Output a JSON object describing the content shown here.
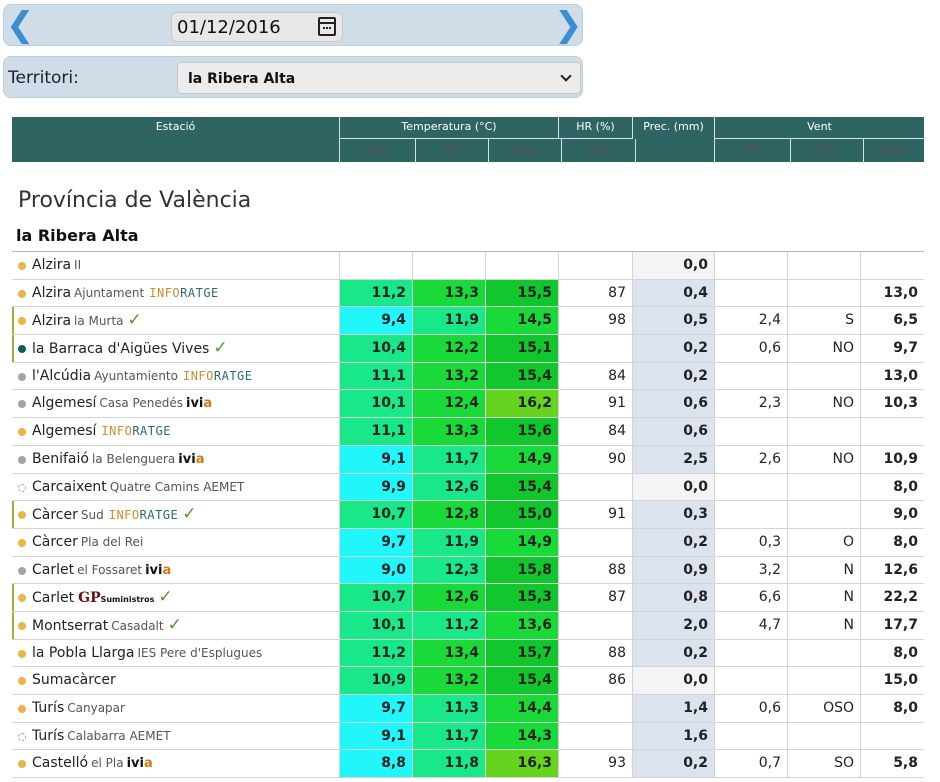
{
  "date": {
    "value": "01/12/2016"
  },
  "territory": {
    "label": "Territori:",
    "selected": "la Ribera Alta"
  },
  "header": {
    "station": "Estació",
    "temperature": "Temperatura (°C)",
    "hr": "HR (%)",
    "prec": "Prec. (mm)",
    "wind": "Vent",
    "sub": {
      "min": "Mín",
      "mit": "Mit",
      "max": "Màx",
      "hr_mit": "Mit",
      "wind_mit": "Mit",
      "dir": "Dir",
      "wind_max": "Màx"
    }
  },
  "province": "Província de València",
  "comarca": "la Ribera Alta",
  "colors": {
    "cyan": "#21f6fa",
    "green_light": "#18e888",
    "green": "#1ada3a",
    "green_dark": "#12c62e",
    "lime": "#66d31e",
    "header": "#2e6461"
  },
  "rows": [
    {
      "name": "Alzira",
      "sub": "II",
      "brand": "",
      "dot": "yellow",
      "check": false,
      "marked": false,
      "tmin": "",
      "tmit": "",
      "tmax": "",
      "hr": "",
      "prec": "0,0",
      "precColor": "none",
      "wmit": "",
      "dir": "",
      "wmax": "",
      "cmin": "",
      "cmit": "",
      "cmax": ""
    },
    {
      "name": "Alzira",
      "sub": "Ajuntament",
      "brand": "info",
      "dot": "yellow",
      "check": false,
      "marked": false,
      "tmin": "11,2",
      "tmit": "13,3",
      "tmax": "15,5",
      "hr": "87",
      "prec": "0,4",
      "precColor": "blue",
      "wmit": "",
      "dir": "",
      "wmax": "13,0",
      "cmin": "#18e888",
      "cmit": "#1ada3a",
      "cmax": "#12c62e"
    },
    {
      "name": "Alzira",
      "sub": "la Murta",
      "brand": "",
      "dot": "yellow",
      "check": true,
      "marked": true,
      "tmin": "9,4",
      "tmit": "11,9",
      "tmax": "14,5",
      "hr": "98",
      "prec": "0,5",
      "precColor": "blue",
      "wmit": "2,4",
      "dir": "S",
      "wmax": "6,5",
      "cmin": "#21f6fa",
      "cmit": "#18e888",
      "cmax": "#1ada3a"
    },
    {
      "name": "la Barraca d'Aigües Vives",
      "sub": "",
      "brand": "",
      "dot": "teal",
      "check": true,
      "marked": true,
      "tmin": "10,4",
      "tmit": "12,2",
      "tmax": "15,1",
      "hr": "",
      "prec": "0,2",
      "precColor": "blue",
      "wmit": "0,6",
      "dir": "NO",
      "wmax": "9,7",
      "cmin": "#18e888",
      "cmit": "#1ada3a",
      "cmax": "#12c62e"
    },
    {
      "name": "l'Alcúdia",
      "sub": "Ayuntamiento",
      "brand": "info",
      "dot": "gray",
      "check": false,
      "marked": false,
      "tmin": "11,1",
      "tmit": "13,2",
      "tmax": "15,4",
      "hr": "84",
      "prec": "0,2",
      "precColor": "blue",
      "wmit": "",
      "dir": "",
      "wmax": "13,0",
      "cmin": "#18e888",
      "cmit": "#1ada3a",
      "cmax": "#12c62e"
    },
    {
      "name": "Algemesí",
      "sub": "Casa Penedés",
      "brand": "ivia",
      "dot": "gray",
      "check": false,
      "marked": false,
      "tmin": "10,1",
      "tmit": "12,4",
      "tmax": "16,2",
      "hr": "91",
      "prec": "0,6",
      "precColor": "blue",
      "wmit": "2,3",
      "dir": "NO",
      "wmax": "10,3",
      "cmin": "#18e888",
      "cmit": "#1ada3a",
      "cmax": "#66d31e"
    },
    {
      "name": "Algemesí",
      "sub": "",
      "brand": "info",
      "dot": "yellow",
      "check": false,
      "marked": false,
      "tmin": "11,1",
      "tmit": "13,3",
      "tmax": "15,6",
      "hr": "84",
      "prec": "0,6",
      "precColor": "blue",
      "wmit": "",
      "dir": "",
      "wmax": "",
      "cmin": "#18e888",
      "cmit": "#1ada3a",
      "cmax": "#12c62e"
    },
    {
      "name": "Benifaió",
      "sub": "la Belenguera",
      "brand": "ivia",
      "dot": "gray",
      "check": false,
      "marked": false,
      "tmin": "9,1",
      "tmit": "11,7",
      "tmax": "14,9",
      "hr": "90",
      "prec": "2,5",
      "precColor": "blue",
      "wmit": "2,6",
      "dir": "NO",
      "wmax": "10,9",
      "cmin": "#21f6fa",
      "cmit": "#18e888",
      "cmax": "#1ada3a"
    },
    {
      "name": "Carcaixent",
      "sub": "Quatre Camins AEMET",
      "brand": "",
      "dot": "hollow",
      "check": false,
      "marked": false,
      "tmin": "9,9",
      "tmit": "12,6",
      "tmax": "15,4",
      "hr": "",
      "prec": "0,0",
      "precColor": "none",
      "wmit": "",
      "dir": "",
      "wmax": "8,0",
      "cmin": "#21f6fa",
      "cmit": "#18e888",
      "cmax": "#12c62e"
    },
    {
      "name": "Càrcer",
      "sub": "Sud",
      "brand": "info",
      "dot": "yellow",
      "check": true,
      "marked": true,
      "tmin": "10,7",
      "tmit": "12,8",
      "tmax": "15,0",
      "hr": "91",
      "prec": "0,3",
      "precColor": "blue",
      "wmit": "",
      "dir": "",
      "wmax": "9,0",
      "cmin": "#18e888",
      "cmit": "#1ada3a",
      "cmax": "#12c62e"
    },
    {
      "name": "Càrcer",
      "sub": "Pla del Rei",
      "brand": "",
      "dot": "yellow",
      "check": false,
      "marked": false,
      "tmin": "9,7",
      "tmit": "11,9",
      "tmax": "14,9",
      "hr": "",
      "prec": "0,2",
      "precColor": "blue",
      "wmit": "0,3",
      "dir": "O",
      "wmax": "8,0",
      "cmin": "#21f6fa",
      "cmit": "#18e888",
      "cmax": "#1ada3a"
    },
    {
      "name": "Carlet",
      "sub": "el Fossaret",
      "brand": "ivia",
      "dot": "gray",
      "check": false,
      "marked": false,
      "tmin": "9,0",
      "tmit": "12,3",
      "tmax": "15,8",
      "hr": "88",
      "prec": "0,9",
      "precColor": "blue",
      "wmit": "3,2",
      "dir": "N",
      "wmax": "12,6",
      "cmin": "#21f6fa",
      "cmit": "#18e888",
      "cmax": "#12c62e"
    },
    {
      "name": "Carlet",
      "sub": "",
      "brand": "gp",
      "dot": "yellow",
      "check": true,
      "marked": true,
      "tmin": "10,7",
      "tmit": "12,6",
      "tmax": "15,3",
      "hr": "87",
      "prec": "0,8",
      "precColor": "blue",
      "wmit": "6,6",
      "dir": "N",
      "wmax": "22,2",
      "cmin": "#18e888",
      "cmit": "#1ada3a",
      "cmax": "#12c62e"
    },
    {
      "name": "Montserrat",
      "sub": "Casadalt",
      "brand": "",
      "dot": "yellow",
      "check": true,
      "marked": true,
      "tmin": "10,1",
      "tmit": "11,2",
      "tmax": "13,6",
      "hr": "",
      "prec": "2,0",
      "precColor": "blue",
      "wmit": "4,7",
      "dir": "N",
      "wmax": "17,7",
      "cmin": "#18e888",
      "cmit": "#18e888",
      "cmax": "#1ada3a"
    },
    {
      "name": "la Pobla Llarga",
      "sub": "IES Pere d'Esplugues",
      "brand": "",
      "dot": "yellow",
      "check": false,
      "marked": false,
      "tmin": "11,2",
      "tmit": "13,4",
      "tmax": "15,7",
      "hr": "88",
      "prec": "0,2",
      "precColor": "blue",
      "wmit": "",
      "dir": "",
      "wmax": "8,0",
      "cmin": "#18e888",
      "cmit": "#1ada3a",
      "cmax": "#12c62e"
    },
    {
      "name": "Sumacàrcer",
      "sub": "",
      "brand": "",
      "dot": "yellow",
      "check": false,
      "marked": false,
      "tmin": "10,9",
      "tmit": "13,2",
      "tmax": "15,4",
      "hr": "86",
      "prec": "0,0",
      "precColor": "none",
      "wmit": "",
      "dir": "",
      "wmax": "15,0",
      "cmin": "#18e888",
      "cmit": "#1ada3a",
      "cmax": "#12c62e"
    },
    {
      "name": "Turís",
      "sub": "Canyapar",
      "brand": "",
      "dot": "yellow",
      "check": false,
      "marked": false,
      "tmin": "9,7",
      "tmit": "11,3",
      "tmax": "14,4",
      "hr": "",
      "prec": "1,4",
      "precColor": "blue",
      "wmit": "0,6",
      "dir": "OSO",
      "wmax": "8,0",
      "cmin": "#21f6fa",
      "cmit": "#18e888",
      "cmax": "#1ada3a"
    },
    {
      "name": "Turís",
      "sub": "Calabarra AEMET",
      "brand": "",
      "dot": "hollow",
      "check": false,
      "marked": false,
      "tmin": "9,1",
      "tmit": "11,7",
      "tmax": "14,3",
      "hr": "",
      "prec": "1,6",
      "precColor": "blue",
      "wmit": "",
      "dir": "",
      "wmax": "",
      "cmin": "#21f6fa",
      "cmit": "#18e888",
      "cmax": "#1ada3a"
    },
    {
      "name": "Castelló",
      "sub": "el Pla",
      "brand": "ivia",
      "dot": "yellow",
      "check": false,
      "marked": false,
      "tmin": "8,8",
      "tmit": "11,8",
      "tmax": "16,3",
      "hr": "93",
      "prec": "0,2",
      "precColor": "blue",
      "wmit": "0,7",
      "dir": "SO",
      "wmax": "5,8",
      "cmin": "#21f6fa",
      "cmit": "#18e888",
      "cmax": "#66d31e"
    }
  ]
}
